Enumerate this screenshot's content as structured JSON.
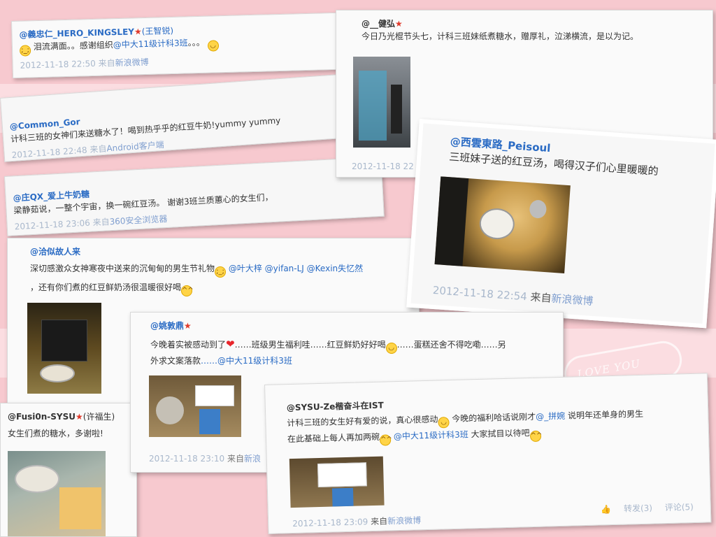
{
  "decoration": {
    "stamp_text": "LOVE YOU"
  },
  "posts": {
    "p1": {
      "user": "@義忠仁_HERO_KINGSLEY",
      "extra": "(王智锐)",
      "text_a": "泪流满面。。感谢组织",
      "link": "@中大11级计科3班",
      "text_b": "。。。",
      "time": "2012-11-18 22:50",
      "via": "来自",
      "source": "新浪微博"
    },
    "p2": {
      "user": "@Common_Gor",
      "text": "计科三班的女神们来送糖水了！喝到热乎乎的红豆牛奶!yummy yummy",
      "time": "2012-11-18 22:48",
      "via": "来自",
      "source": "Android客户端"
    },
    "p3": {
      "user": "@庄QX_爱上牛奶糖",
      "text": "梁静茹说，一整个宇宙，换一碗红豆汤。 谢谢3班兰质蕙心的女生们，",
      "time": "2012-11-18 23:06",
      "via": "来自",
      "source": "360安全浏览器"
    },
    "p4": {
      "user": "@__健弘",
      "text": "今日乃光棍节头七，计科三班妹纸煮糖水，赠厚礼，泣涕横流，是以为记。",
      "time": "2012-11-18 22"
    },
    "p5": {
      "user": "@西雲東路_Peisoul",
      "text": "三班妹子送的红豆汤，喝得汉子们心里暖暖的",
      "time": "2012-11-18 22:54",
      "via": "来自",
      "source": "新浪微博"
    },
    "p6": {
      "user": "@洽似故人来",
      "text_a": "深切感激众女神寒夜中送来的沉甸甸的男生节礼物",
      "mentions": "@叶大梓 @yifan-LJ @Kexin失忆然",
      "text_b": "，还有你们煮的红豆鲜奶汤很温暖很好喝"
    },
    "p7": {
      "user": "@姚敦鼎",
      "text_a": "今晚着实被感动到了",
      "text_b": "……班级男生福利哇……红豆鲜奶好好喝",
      "text_c": "……蛋糕还舍不得吃嘞……另",
      "text_d": "外求文案落款",
      "link": "……@中大11级计科3班",
      "time": "2012-11-18 23:10",
      "via": "来自",
      "source": "新浪"
    },
    "p8": {
      "user": "@Fusi0n-SYSU",
      "extra": "(许福生)",
      "text": "女生们煮的糖水，多谢啦!"
    },
    "p9": {
      "user": "@SYSU-Ze楷奋斗在IST",
      "text_a": "计科三班的女生好有爱的说，真心很感动",
      "text_b": "今晚的福利哈话说刚才",
      "link_a": "@_拼婉",
      "text_c": "说明年还单身的男生",
      "text_d": "在此基础上每人再加两碗",
      "link_b": "@中大11级计科3班",
      "text_e": "大家拭目以待吧",
      "time": "2012-11-18 23:09",
      "via": "来自",
      "source": "新浪微博",
      "repost": "转发(3)",
      "comment": "评论(5)"
    }
  }
}
